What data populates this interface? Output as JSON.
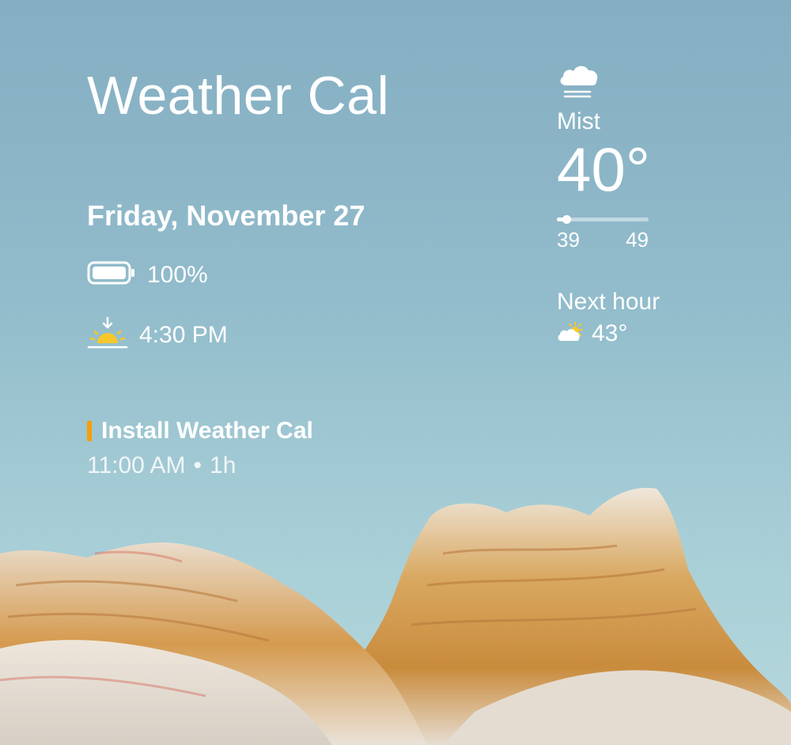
{
  "widget": {
    "title": "Weather Cal",
    "date": "Friday, November 27",
    "battery": {
      "icon": "battery-icon",
      "level_text": "100%",
      "level": 1.0
    },
    "sunset": {
      "icon": "sunset-icon",
      "time": "4:30 PM"
    },
    "event": {
      "title": "Install Weather Cal",
      "time": "11:00 AM",
      "separator": "•",
      "duration": "1h",
      "calendar_color": "#f59e0b"
    },
    "current": {
      "icon": "mist-cloud-icon",
      "condition": "Mist",
      "temperature": "40°",
      "low": "39",
      "high": "49",
      "current_position": 0.1
    },
    "next_hour": {
      "label": "Next hour",
      "icon": "partly-sunny-icon",
      "temperature": "43°"
    }
  },
  "colors": {
    "accent_orange": "#f59e0b",
    "sun_yellow": "#f6c82b",
    "sky_top": "#84aec2",
    "sky_bottom": "#b5d8dc"
  }
}
